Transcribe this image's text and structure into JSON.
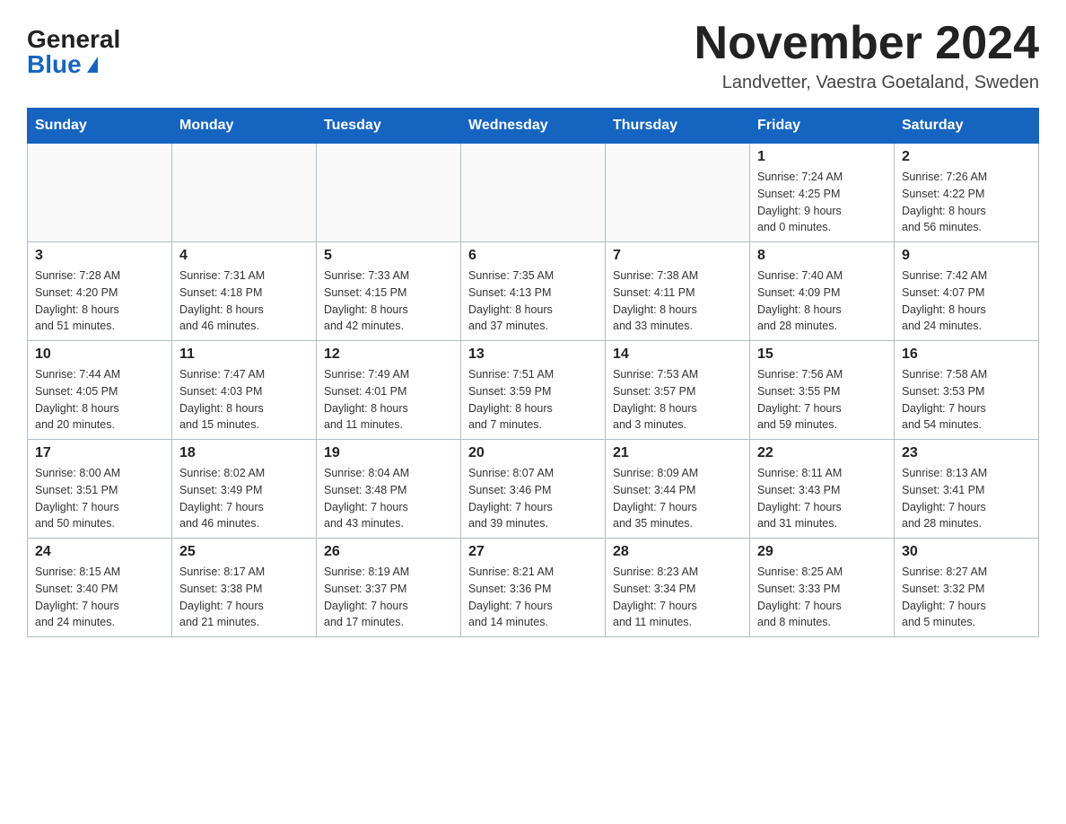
{
  "header": {
    "logo_general": "General",
    "logo_blue": "Blue",
    "month_title": "November 2024",
    "location": "Landvetter, Vaestra Goetaland, Sweden"
  },
  "days_of_week": [
    "Sunday",
    "Monday",
    "Tuesday",
    "Wednesday",
    "Thursday",
    "Friday",
    "Saturday"
  ],
  "weeks": [
    [
      {
        "day": "",
        "info": ""
      },
      {
        "day": "",
        "info": ""
      },
      {
        "day": "",
        "info": ""
      },
      {
        "day": "",
        "info": ""
      },
      {
        "day": "",
        "info": ""
      },
      {
        "day": "1",
        "info": "Sunrise: 7:24 AM\nSunset: 4:25 PM\nDaylight: 9 hours\nand 0 minutes."
      },
      {
        "day": "2",
        "info": "Sunrise: 7:26 AM\nSunset: 4:22 PM\nDaylight: 8 hours\nand 56 minutes."
      }
    ],
    [
      {
        "day": "3",
        "info": "Sunrise: 7:28 AM\nSunset: 4:20 PM\nDaylight: 8 hours\nand 51 minutes."
      },
      {
        "day": "4",
        "info": "Sunrise: 7:31 AM\nSunset: 4:18 PM\nDaylight: 8 hours\nand 46 minutes."
      },
      {
        "day": "5",
        "info": "Sunrise: 7:33 AM\nSunset: 4:15 PM\nDaylight: 8 hours\nand 42 minutes."
      },
      {
        "day": "6",
        "info": "Sunrise: 7:35 AM\nSunset: 4:13 PM\nDaylight: 8 hours\nand 37 minutes."
      },
      {
        "day": "7",
        "info": "Sunrise: 7:38 AM\nSunset: 4:11 PM\nDaylight: 8 hours\nand 33 minutes."
      },
      {
        "day": "8",
        "info": "Sunrise: 7:40 AM\nSunset: 4:09 PM\nDaylight: 8 hours\nand 28 minutes."
      },
      {
        "day": "9",
        "info": "Sunrise: 7:42 AM\nSunset: 4:07 PM\nDaylight: 8 hours\nand 24 minutes."
      }
    ],
    [
      {
        "day": "10",
        "info": "Sunrise: 7:44 AM\nSunset: 4:05 PM\nDaylight: 8 hours\nand 20 minutes."
      },
      {
        "day": "11",
        "info": "Sunrise: 7:47 AM\nSunset: 4:03 PM\nDaylight: 8 hours\nand 15 minutes."
      },
      {
        "day": "12",
        "info": "Sunrise: 7:49 AM\nSunset: 4:01 PM\nDaylight: 8 hours\nand 11 minutes."
      },
      {
        "day": "13",
        "info": "Sunrise: 7:51 AM\nSunset: 3:59 PM\nDaylight: 8 hours\nand 7 minutes."
      },
      {
        "day": "14",
        "info": "Sunrise: 7:53 AM\nSunset: 3:57 PM\nDaylight: 8 hours\nand 3 minutes."
      },
      {
        "day": "15",
        "info": "Sunrise: 7:56 AM\nSunset: 3:55 PM\nDaylight: 7 hours\nand 59 minutes."
      },
      {
        "day": "16",
        "info": "Sunrise: 7:58 AM\nSunset: 3:53 PM\nDaylight: 7 hours\nand 54 minutes."
      }
    ],
    [
      {
        "day": "17",
        "info": "Sunrise: 8:00 AM\nSunset: 3:51 PM\nDaylight: 7 hours\nand 50 minutes."
      },
      {
        "day": "18",
        "info": "Sunrise: 8:02 AM\nSunset: 3:49 PM\nDaylight: 7 hours\nand 46 minutes."
      },
      {
        "day": "19",
        "info": "Sunrise: 8:04 AM\nSunset: 3:48 PM\nDaylight: 7 hours\nand 43 minutes."
      },
      {
        "day": "20",
        "info": "Sunrise: 8:07 AM\nSunset: 3:46 PM\nDaylight: 7 hours\nand 39 minutes."
      },
      {
        "day": "21",
        "info": "Sunrise: 8:09 AM\nSunset: 3:44 PM\nDaylight: 7 hours\nand 35 minutes."
      },
      {
        "day": "22",
        "info": "Sunrise: 8:11 AM\nSunset: 3:43 PM\nDaylight: 7 hours\nand 31 minutes."
      },
      {
        "day": "23",
        "info": "Sunrise: 8:13 AM\nSunset: 3:41 PM\nDaylight: 7 hours\nand 28 minutes."
      }
    ],
    [
      {
        "day": "24",
        "info": "Sunrise: 8:15 AM\nSunset: 3:40 PM\nDaylight: 7 hours\nand 24 minutes."
      },
      {
        "day": "25",
        "info": "Sunrise: 8:17 AM\nSunset: 3:38 PM\nDaylight: 7 hours\nand 21 minutes."
      },
      {
        "day": "26",
        "info": "Sunrise: 8:19 AM\nSunset: 3:37 PM\nDaylight: 7 hours\nand 17 minutes."
      },
      {
        "day": "27",
        "info": "Sunrise: 8:21 AM\nSunset: 3:36 PM\nDaylight: 7 hours\nand 14 minutes."
      },
      {
        "day": "28",
        "info": "Sunrise: 8:23 AM\nSunset: 3:34 PM\nDaylight: 7 hours\nand 11 minutes."
      },
      {
        "day": "29",
        "info": "Sunrise: 8:25 AM\nSunset: 3:33 PM\nDaylight: 7 hours\nand 8 minutes."
      },
      {
        "day": "30",
        "info": "Sunrise: 8:27 AM\nSunset: 3:32 PM\nDaylight: 7 hours\nand 5 minutes."
      }
    ]
  ]
}
